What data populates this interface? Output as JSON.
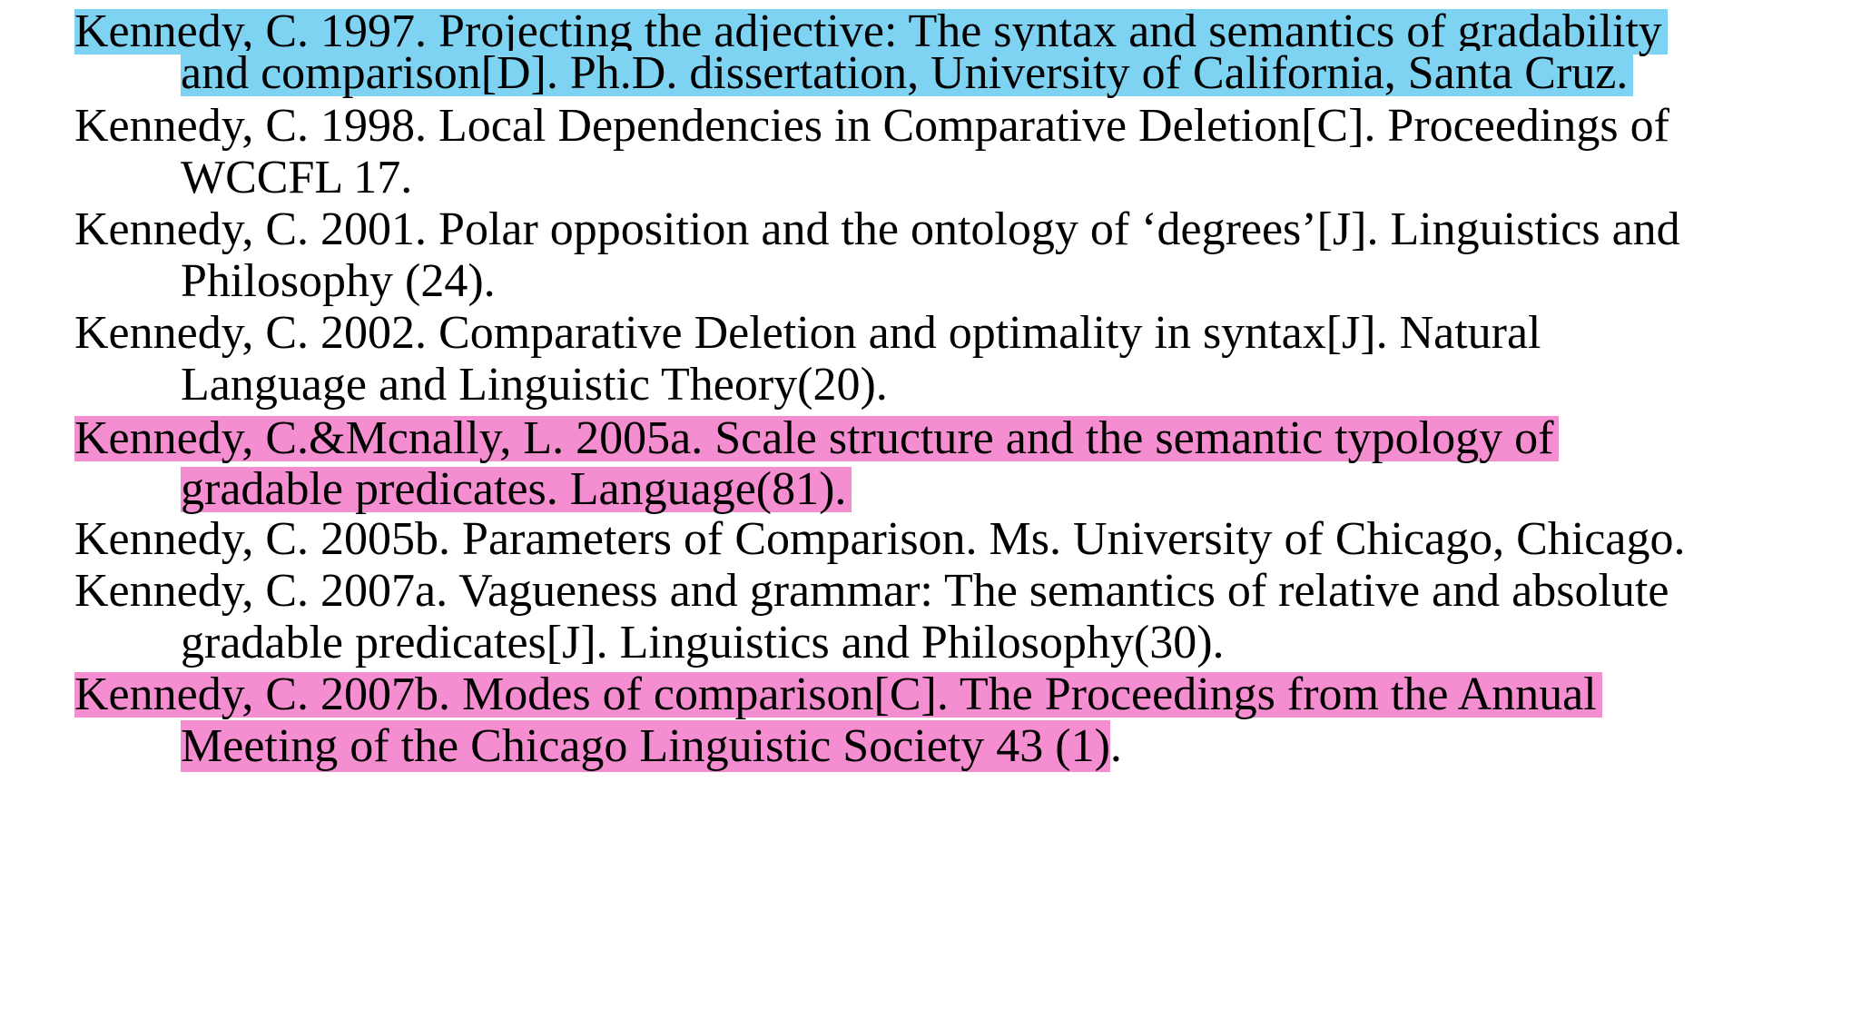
{
  "references": [
    {
      "highlight": "blue",
      "line1": "Kennedy, C. 1997. Projecting the adjective: The syntax and semantics of gradability",
      "line2": "and comparison[D]. Ph.D. dissertation, University of California, Santa Cruz."
    },
    {
      "highlight": "none",
      "line1": "Kennedy, C. 1998. Local Dependencies in Comparative Deletion[C]. Proceedings of",
      "line2": "WCCFL 17."
    },
    {
      "highlight": "none",
      "line1": "Kennedy, C. 2001. Polar opposition and the ontology of ‘degrees’[J]. Linguistics and",
      "line2": "Philosophy (24)."
    },
    {
      "highlight": "none",
      "line1": "Kennedy, C. 2002. Comparative Deletion and optimality in syntax[J]. Natural",
      "line2": "Language and Linguistic Theory(20)."
    },
    {
      "highlight": "pink",
      "line1": "Kennedy, C.&Mcnally, L. 2005a. Scale structure and the semantic typology of",
      "line2": "gradable predicates. Language(81)."
    },
    {
      "highlight": "none",
      "line1": "Kennedy, C. 2005b. Parameters of Comparison. Ms. University of Chicago, Chicago."
    },
    {
      "highlight": "none",
      "line1": "Kennedy, C. 2007a. Vagueness and grammar: The semantics of relative and absolute",
      "line2": "gradable predicates[J]. Linguistics and Philosophy(30)."
    },
    {
      "highlight": "pink",
      "line1": "Kennedy, C. 2007b. Modes of comparison[C]. The Proceedings from the Annual",
      "line2_highlighted": "Meeting of the Chicago Linguistic Society 43 (1)",
      "line2_tail": "."
    }
  ],
  "colors": {
    "highlight_blue": "#7fd3f2",
    "highlight_pink": "#f48ed0",
    "text": "#000000"
  }
}
